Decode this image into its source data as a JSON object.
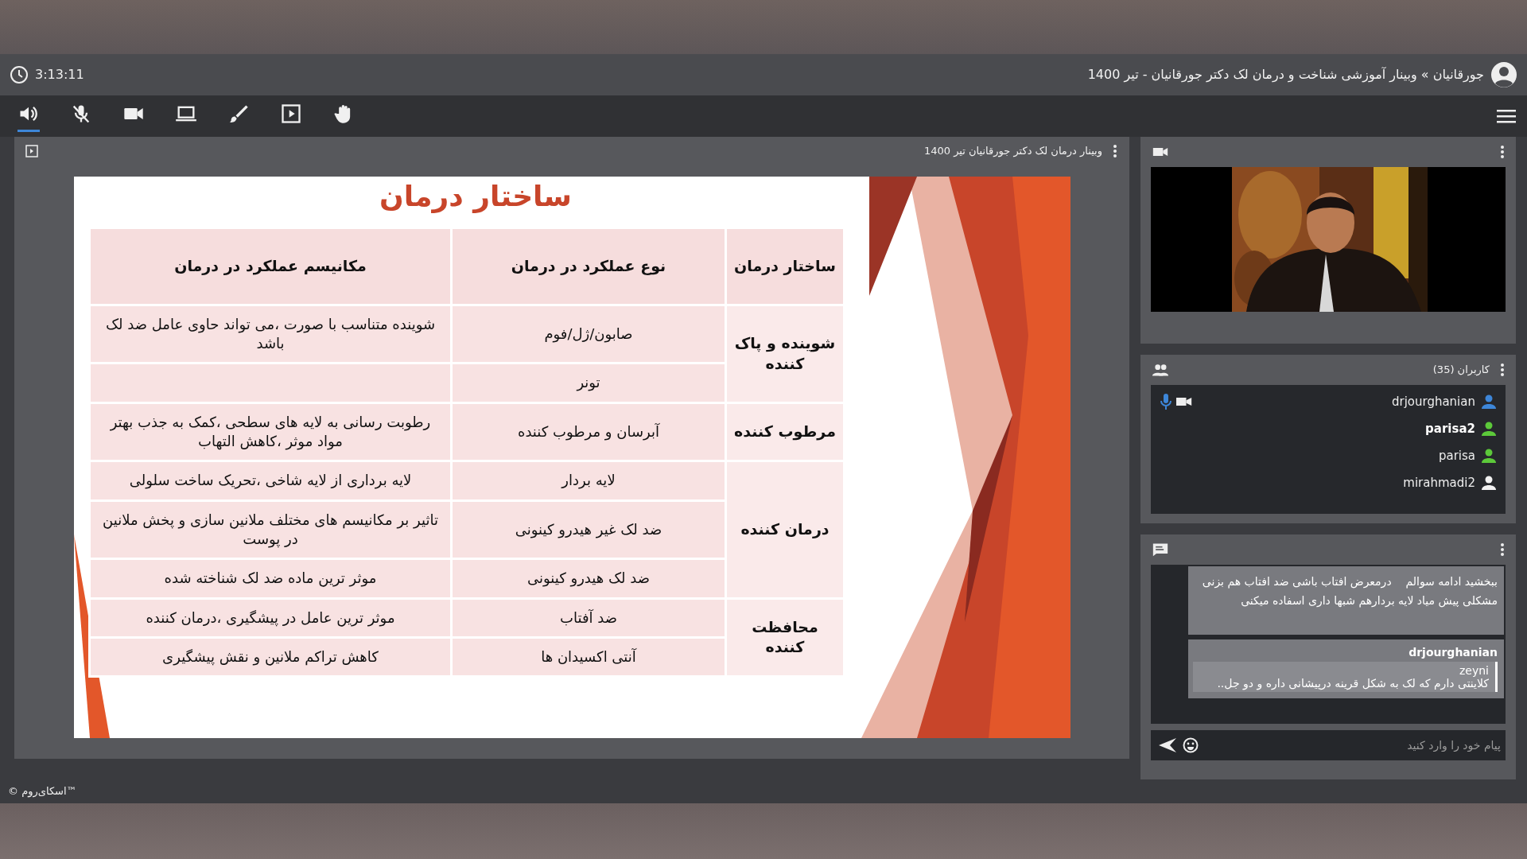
{
  "header": {
    "time": "3:13:11",
    "title": "جورقانیان » وبینار آموزشی شناخت و درمان لک دکتر جورقانیان - تیر 1400"
  },
  "toolbar": {
    "tools": [
      {
        "kind": "speaker",
        "selected": true
      },
      {
        "kind": "mic-off",
        "selected": false
      },
      {
        "kind": "camera",
        "selected": false
      },
      {
        "kind": "screen",
        "selected": false
      },
      {
        "kind": "brush",
        "selected": false
      },
      {
        "kind": "play-box",
        "selected": false
      },
      {
        "kind": "hand",
        "selected": false
      }
    ]
  },
  "presentation": {
    "title": "وبینار درمان لک دکتر جورقانیان تیر 1400",
    "slide": {
      "heading": "ساختار درمان",
      "columns": [
        "ساختار درمان",
        "نوع عملکرد در درمان",
        "مکانیسم عملکرد در درمان"
      ],
      "groups": [
        {
          "structure": "شوینده و پاک کننده",
          "items": [
            {
              "type": "صابون/ژل/فوم",
              "mechanism": "شوینده متناسب با صورت ،می تواند حاوی عامل ضد لک باشد"
            },
            {
              "type": "تونر"
            }
          ]
        },
        {
          "structure": "مرطوب کننده",
          "items": [
            {
              "type": "آبرسان و مرطوب کننده",
              "mechanism": "رطوبت رسانی به لایه های سطحی ،کمک به جذب بهتر مواد موثر ،کاهش التهاب"
            }
          ]
        },
        {
          "structure": "درمان کننده",
          "items": [
            {
              "type": "لایه بردار",
              "mechanism": "لایه برداری از لایه شاخی ،تحریک ساخت سلولی"
            },
            {
              "type": "ضد لک غیر هیدرو کینونی",
              "mechanism": "تاثیر بر مکانیسم های مختلف ملانین سازی و پخش ملانین در پوست"
            },
            {
              "type": "ضد لک هیدرو کینونی",
              "mechanism": "موثر ترین ماده ضد لک شناخته شده"
            }
          ]
        },
        {
          "structure": "محافظت کننده",
          "items": [
            {
              "type": "ضد آفتاب",
              "mechanism": "موثر ترین عامل در پیشگیری ،درمان کننده"
            },
            {
              "type": "آنتی اکسیدان ها",
              "mechanism": "کاهش تراکم ملانین و نقش پیشگیری"
            }
          ]
        }
      ]
    }
  },
  "users": {
    "title": "کاربران (35)",
    "items": [
      {
        "name": "drjourghanian",
        "color": "#3d86d8",
        "current": false,
        "mic": true,
        "camera": true
      },
      {
        "name": "parisa2",
        "color": "#5cc93a",
        "current": true,
        "mic": false,
        "camera": false
      },
      {
        "name": "parisa",
        "color": "#5cc93a",
        "current": false,
        "mic": false,
        "camera": false
      },
      {
        "name": "mirahmadi2",
        "color": "#f2f2f2",
        "current": false,
        "mic": false,
        "camera": false
      }
    ]
  },
  "chat": {
    "messages": [
      {
        "text": "ببخشید ادامه سوالم    درمعرض افتاب باشی ضد افتاب هم بزنی مشکلی پیش میاد لایه بردارهم شبها داری اسفاده میکنی"
      },
      {
        "sender": "drjourghanian",
        "quote_author": "zeyni",
        "quote_text": "کلاینتی دارم که لک به شکل قرینه درپیشانی داره و دو جل.."
      }
    ],
    "input": {
      "placeholder": "پیام خود را وارد کنید"
    }
  },
  "footer": {
    "brand": "© اسکای‌روم™"
  }
}
